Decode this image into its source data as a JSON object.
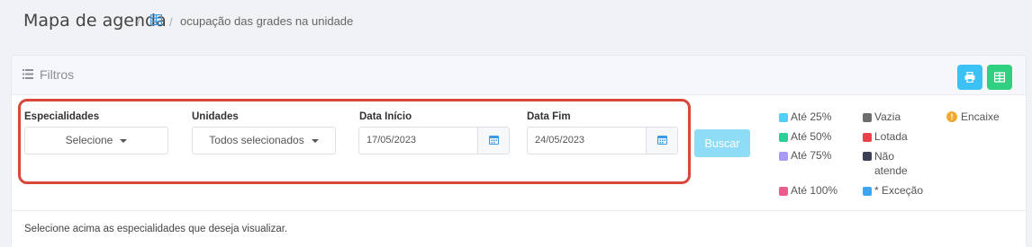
{
  "header": {
    "title": "Mapa de agenda",
    "separator": "/",
    "breadcrumb_icon": "grid-icon",
    "breadcrumb_text": "ocupação das grades na unidade"
  },
  "filters": {
    "header_icon": "list-icon",
    "header_label": "Filtros",
    "print_icon": "print-icon",
    "excel_icon": "spreadsheet-icon",
    "especialidades": {
      "label": "Especialidades",
      "value": "Selecione"
    },
    "unidades": {
      "label": "Unidades",
      "value": "Todos selecionados"
    },
    "data_inicio": {
      "label": "Data Início",
      "value": "17/05/2023"
    },
    "data_fim": {
      "label": "Data Fim",
      "value": "24/05/2023"
    },
    "calendar_icon": "calendar-icon",
    "buscar_label": "Buscar"
  },
  "legend": {
    "items": [
      {
        "label": "Até 25%",
        "color": "#4fd1f7"
      },
      {
        "label": "Até 50%",
        "color": "#2ecf96"
      },
      {
        "label": "Até 75%",
        "color": "#a99bf4"
      },
      {
        "label": "Até 100%",
        "color": "#f05b8e"
      },
      {
        "label": "Vazia",
        "color": "#6e6e6e"
      },
      {
        "label": "Lotada",
        "color": "#e8424d"
      },
      {
        "label": "Não atende",
        "color": "#3a4157"
      },
      {
        "label": "* Exceção",
        "color": "#3ba5f0"
      }
    ],
    "encaixe_label": "Encaixe",
    "encaixe_color": "#f0a935"
  },
  "message": "Selecione acima as especialidades que deseja visualizar.",
  "colors": {
    "highlight": "#d9473b",
    "print_button": "#3bc1f3",
    "excel_button": "#2fd07f",
    "buscar_button": "#8fdcf6"
  }
}
